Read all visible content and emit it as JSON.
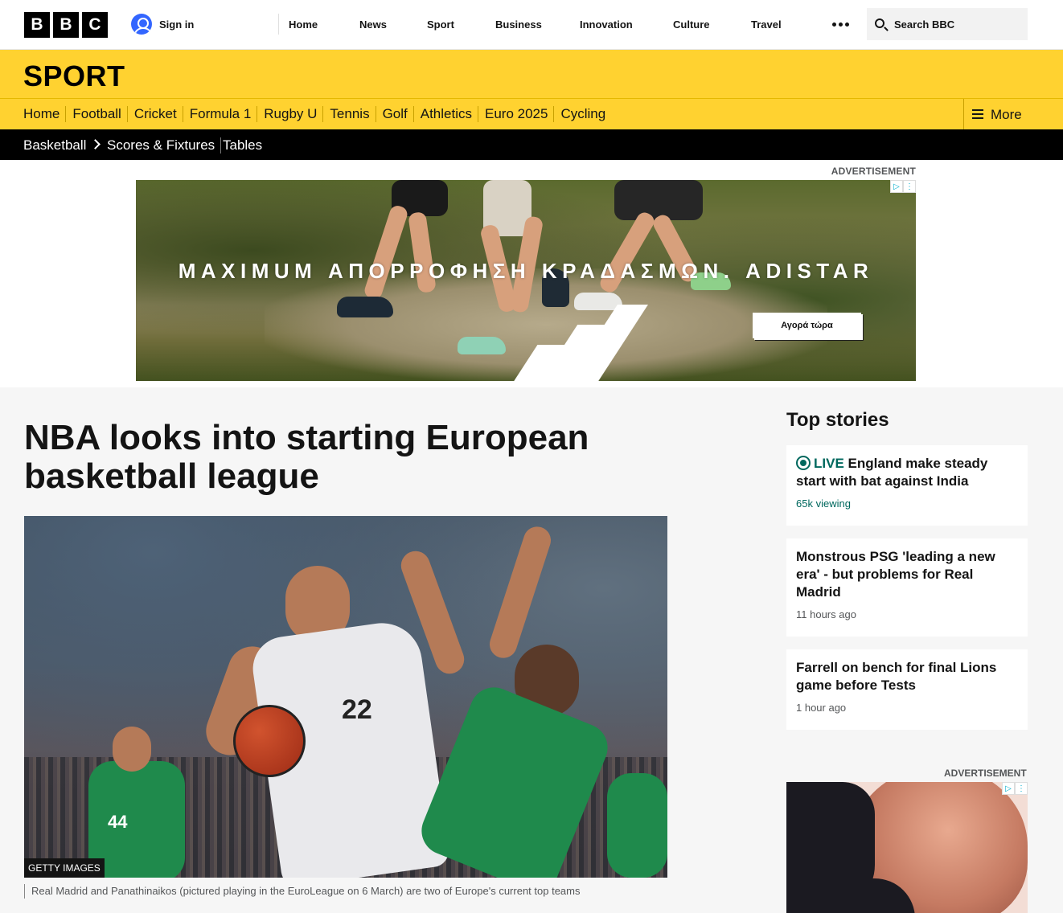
{
  "topbar": {
    "logo_letters": [
      "B",
      "B",
      "C"
    ],
    "signin": "Sign in",
    "nav": [
      "Home",
      "News",
      "Sport",
      "Business",
      "Innovation",
      "Culture",
      "Travel"
    ],
    "search_placeholder": "Search BBC"
  },
  "sport": {
    "title": "SPORT",
    "nav": [
      "Home",
      "Football",
      "Cricket",
      "Formula 1",
      "Rugby U",
      "Tennis",
      "Golf",
      "Athletics",
      "Euro 2025",
      "Cycling"
    ],
    "more": "More"
  },
  "subnav": {
    "section": "Basketball",
    "links": [
      "Scores & Fixtures",
      "Tables"
    ]
  },
  "ad": {
    "label": "ADVERTISEMENT",
    "banner_text": "MAXIMUM ΑΠΟΡΡΟΦΗΣΗ ΚΡΑΔΑΣΜΩΝ. ADISTAR",
    "cta": "Αγορά τώρα"
  },
  "article": {
    "headline": "NBA looks into starting European basketball league",
    "image_credit": "GETTY IMAGES",
    "caption": "Real Madrid and Panathinaikos (pictured playing in the EuroLeague on 6 March) are two of Europe's current top teams",
    "jersey_white": "22",
    "jersey_green": "44"
  },
  "sidebar": {
    "title": "Top stories",
    "stories": [
      {
        "live": "LIVE",
        "title": "England make steady start with bat against India",
        "meta": "65k viewing"
      },
      {
        "title": "Monstrous PSG 'leading a new era' - but problems for Real Madrid",
        "meta": "11 hours ago"
      },
      {
        "title": "Farrell on bench for final Lions game before Tests",
        "meta": "1 hour ago"
      }
    ],
    "ad_label": "ADVERTISEMENT"
  },
  "colors": {
    "sport_yellow": "#ffd230",
    "live_green": "#00685e",
    "signin_blue": "#3366ff"
  }
}
